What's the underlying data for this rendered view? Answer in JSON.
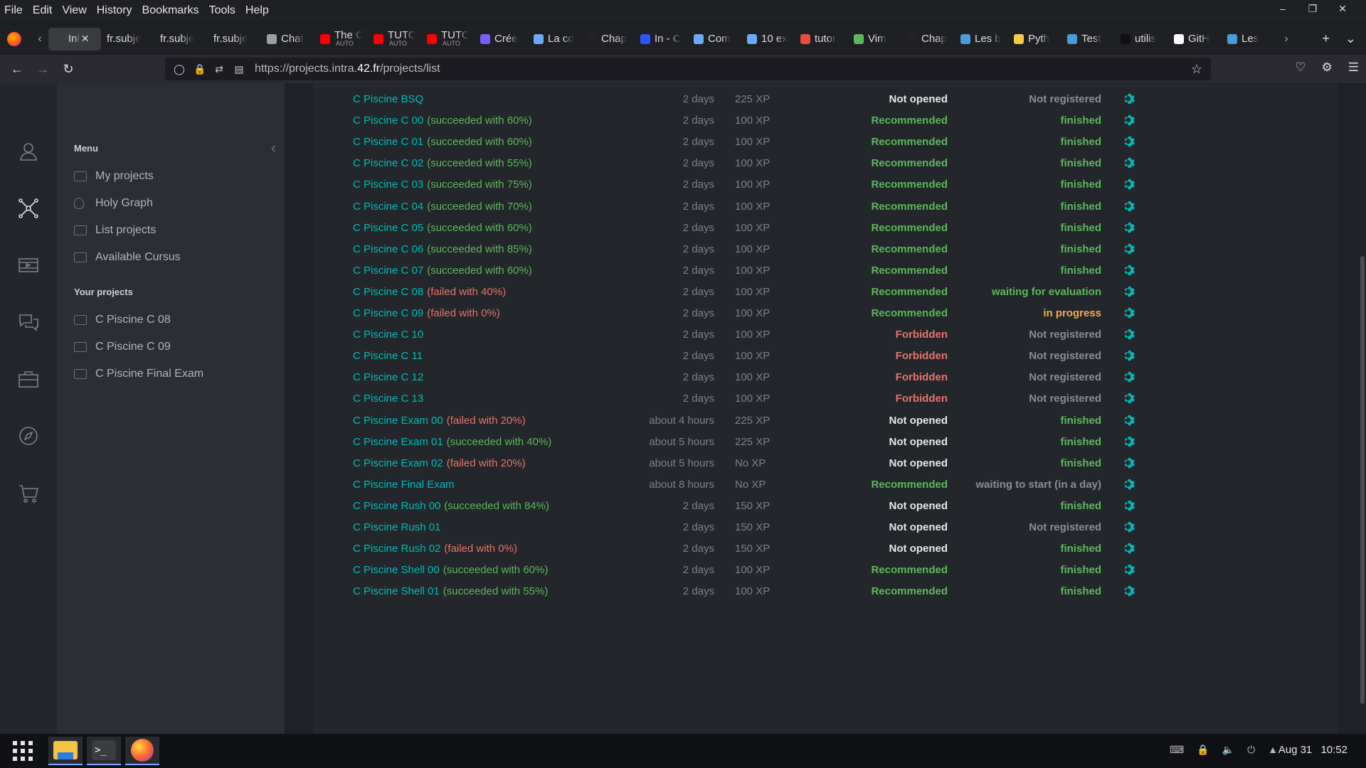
{
  "menubar": {
    "items": [
      {
        "label": "File"
      },
      {
        "label": "Edit"
      },
      {
        "label": "View"
      },
      {
        "label": "History"
      },
      {
        "label": "Bookmarks"
      },
      {
        "label": "Tools"
      },
      {
        "label": "Help"
      }
    ]
  },
  "tabs": [
    {
      "label": "Inl",
      "color": "#3a3c40",
      "active": true
    },
    {
      "label": "fr.subje",
      "color": ""
    },
    {
      "label": "fr.subje",
      "color": ""
    },
    {
      "label": "fr.subje",
      "color": ""
    },
    {
      "label": "Chat",
      "color": "#9aa0a6"
    },
    {
      "label": "The C",
      "sub": "AUTO",
      "color": "#ff0000"
    },
    {
      "label": "TUTO",
      "sub": "AUTO",
      "color": "#ff0000"
    },
    {
      "label": "TUTO",
      "sub": "AUTO",
      "color": "#ff0000"
    },
    {
      "label": "Crée",
      "color": "#7b5cff"
    },
    {
      "label": "La co",
      "color": "#6aa9ff"
    },
    {
      "label": "Chap",
      "color": "#222222"
    },
    {
      "label": "In - C",
      "color": "#2b55ff"
    },
    {
      "label": "Com",
      "color": "#6aa9ff"
    },
    {
      "label": "10 ex",
      "color": "#6aa9ff"
    },
    {
      "label": "tutor",
      "color": "#e74c3c"
    },
    {
      "label": "Vim",
      "color": "#5cb85c"
    },
    {
      "label": "Chap",
      "color": "#222222"
    },
    {
      "label": "Les b",
      "color": "#4a9bd6"
    },
    {
      "label": "Pyth",
      "color": "#f7c948"
    },
    {
      "label": "Test",
      "color": "#4a9bd6"
    },
    {
      "label": "utilis",
      "color": "#111111"
    },
    {
      "label": "GitH",
      "color": "#ffffff"
    },
    {
      "label": "Les",
      "color": "#4a9bd6"
    }
  ],
  "address": {
    "prefix": "https://projects.intra.",
    "domain": "42.fr",
    "path": "/projects/list"
  },
  "sidebar": {
    "menu_title": "Menu",
    "menu_items": [
      {
        "label": "My projects"
      },
      {
        "label": "Holy Graph"
      },
      {
        "label": "List projects"
      },
      {
        "label": "Available Cursus"
      }
    ],
    "your_projects_title": "Your projects",
    "your_projects": [
      {
        "label": "C Piscine C 08"
      },
      {
        "label": "C Piscine C 09"
      },
      {
        "label": "C Piscine Final Exam"
      }
    ]
  },
  "projects": [
    {
      "name": "C Piscine BSQ",
      "result": "",
      "result_kind": "",
      "duration": "2 days",
      "xp": "225 XP",
      "recommendation": "Not opened",
      "rec_kind": "notopened",
      "status": "Not registered",
      "status_kind": "notreg"
    },
    {
      "name": "C Piscine C 00",
      "result": "(succeeded with 60%)",
      "result_kind": "ok",
      "duration": "2 days",
      "xp": "100 XP",
      "recommendation": "Recommended",
      "rec_kind": "recommended",
      "status": "finished",
      "status_kind": "finished"
    },
    {
      "name": "C Piscine C 01",
      "result": "(succeeded with 60%)",
      "result_kind": "ok",
      "duration": "2 days",
      "xp": "100 XP",
      "recommendation": "Recommended",
      "rec_kind": "recommended",
      "status": "finished",
      "status_kind": "finished"
    },
    {
      "name": "C Piscine C 02",
      "result": "(succeeded with 55%)",
      "result_kind": "ok",
      "duration": "2 days",
      "xp": "100 XP",
      "recommendation": "Recommended",
      "rec_kind": "recommended",
      "status": "finished",
      "status_kind": "finished"
    },
    {
      "name": "C Piscine C 03",
      "result": "(succeeded with 75%)",
      "result_kind": "ok",
      "duration": "2 days",
      "xp": "100 XP",
      "recommendation": "Recommended",
      "rec_kind": "recommended",
      "status": "finished",
      "status_kind": "finished"
    },
    {
      "name": "C Piscine C 04",
      "result": "(succeeded with 70%)",
      "result_kind": "ok",
      "duration": "2 days",
      "xp": "100 XP",
      "recommendation": "Recommended",
      "rec_kind": "recommended",
      "status": "finished",
      "status_kind": "finished"
    },
    {
      "name": "C Piscine C 05",
      "result": "(succeeded with 60%)",
      "result_kind": "ok",
      "duration": "2 days",
      "xp": "100 XP",
      "recommendation": "Recommended",
      "rec_kind": "recommended",
      "status": "finished",
      "status_kind": "finished"
    },
    {
      "name": "C Piscine C 06",
      "result": "(succeeded with 85%)",
      "result_kind": "ok",
      "duration": "2 days",
      "xp": "100 XP",
      "recommendation": "Recommended",
      "rec_kind": "recommended",
      "status": "finished",
      "status_kind": "finished"
    },
    {
      "name": "C Piscine C 07",
      "result": "(succeeded with 60%)",
      "result_kind": "ok",
      "duration": "2 days",
      "xp": "100 XP",
      "recommendation": "Recommended",
      "rec_kind": "recommended",
      "status": "finished",
      "status_kind": "finished"
    },
    {
      "name": "C Piscine C 08",
      "result": "(failed with 40%)",
      "result_kind": "ko",
      "duration": "2 days",
      "xp": "100 XP",
      "recommendation": "Recommended",
      "rec_kind": "recommended",
      "status": "waiting for evaluation",
      "status_kind": "waiteval"
    },
    {
      "name": "C Piscine C 09",
      "result": "(failed with 0%)",
      "result_kind": "ko",
      "duration": "2 days",
      "xp": "100 XP",
      "recommendation": "Recommended",
      "rec_kind": "recommended",
      "status": "in progress",
      "status_kind": "inprog"
    },
    {
      "name": "C Piscine C 10",
      "result": "",
      "result_kind": "",
      "duration": "2 days",
      "xp": "100 XP",
      "recommendation": "Forbidden",
      "rec_kind": "forbidden",
      "status": "Not registered",
      "status_kind": "notreg"
    },
    {
      "name": "C Piscine C 11",
      "result": "",
      "result_kind": "",
      "duration": "2 days",
      "xp": "100 XP",
      "recommendation": "Forbidden",
      "rec_kind": "forbidden",
      "status": "Not registered",
      "status_kind": "notreg"
    },
    {
      "name": "C Piscine C 12",
      "result": "",
      "result_kind": "",
      "duration": "2 days",
      "xp": "100 XP",
      "recommendation": "Forbidden",
      "rec_kind": "forbidden",
      "status": "Not registered",
      "status_kind": "notreg"
    },
    {
      "name": "C Piscine C 13",
      "result": "",
      "result_kind": "",
      "duration": "2 days",
      "xp": "100 XP",
      "recommendation": "Forbidden",
      "rec_kind": "forbidden",
      "status": "Not registered",
      "status_kind": "notreg"
    },
    {
      "name": "C Piscine Exam 00",
      "result": "(failed with 20%)",
      "result_kind": "ko",
      "duration": "about 4 hours",
      "xp": "225 XP",
      "recommendation": "Not opened",
      "rec_kind": "notopened",
      "status": "finished",
      "status_kind": "finished"
    },
    {
      "name": "C Piscine Exam 01",
      "result": "(succeeded with 40%)",
      "result_kind": "ok",
      "duration": "about 5 hours",
      "xp": "225 XP",
      "recommendation": "Not opened",
      "rec_kind": "notopened",
      "status": "finished",
      "status_kind": "finished"
    },
    {
      "name": "C Piscine Exam 02",
      "result": "(failed with 20%)",
      "result_kind": "ko",
      "duration": "about 5 hours",
      "xp": "No XP",
      "recommendation": "Not opened",
      "rec_kind": "notopened",
      "status": "finished",
      "status_kind": "finished"
    },
    {
      "name": "C Piscine Final Exam",
      "result": "",
      "result_kind": "",
      "duration": "about 8 hours",
      "xp": "No XP",
      "recommendation": "Recommended",
      "rec_kind": "recommended",
      "status": "waiting to start (in a day)",
      "status_kind": "waitstart"
    },
    {
      "name": "C Piscine Rush 00",
      "result": "(succeeded with 84%)",
      "result_kind": "ok",
      "duration": "2 days",
      "xp": "150 XP",
      "recommendation": "Not opened",
      "rec_kind": "notopened",
      "status": "finished",
      "status_kind": "finished"
    },
    {
      "name": "C Piscine Rush 01",
      "result": "",
      "result_kind": "",
      "duration": "2 days",
      "xp": "150 XP",
      "recommendation": "Not opened",
      "rec_kind": "notopened",
      "status": "Not registered",
      "status_kind": "notreg"
    },
    {
      "name": "C Piscine Rush 02",
      "result": "(failed with 0%)",
      "result_kind": "ko",
      "duration": "2 days",
      "xp": "150 XP",
      "recommendation": "Not opened",
      "rec_kind": "notopened",
      "status": "finished",
      "status_kind": "finished"
    },
    {
      "name": "C Piscine Shell 00",
      "result": "(succeeded with 60%)",
      "result_kind": "ok",
      "duration": "2 days",
      "xp": "100 XP",
      "recommendation": "Recommended",
      "rec_kind": "recommended",
      "status": "finished",
      "status_kind": "finished"
    },
    {
      "name": "C Piscine Shell 01",
      "result": "(succeeded with 55%)",
      "result_kind": "ok",
      "duration": "2 days",
      "xp": "100 XP",
      "recommendation": "Recommended",
      "rec_kind": "recommended",
      "status": "finished",
      "status_kind": "finished"
    }
  ],
  "taskbar": {
    "date": "Aug 31",
    "time": "10:52"
  },
  "colors": {
    "accent": "#00bcba",
    "success": "#5cb85c",
    "danger": "#e5736b",
    "warning": "#f0ad4e"
  }
}
